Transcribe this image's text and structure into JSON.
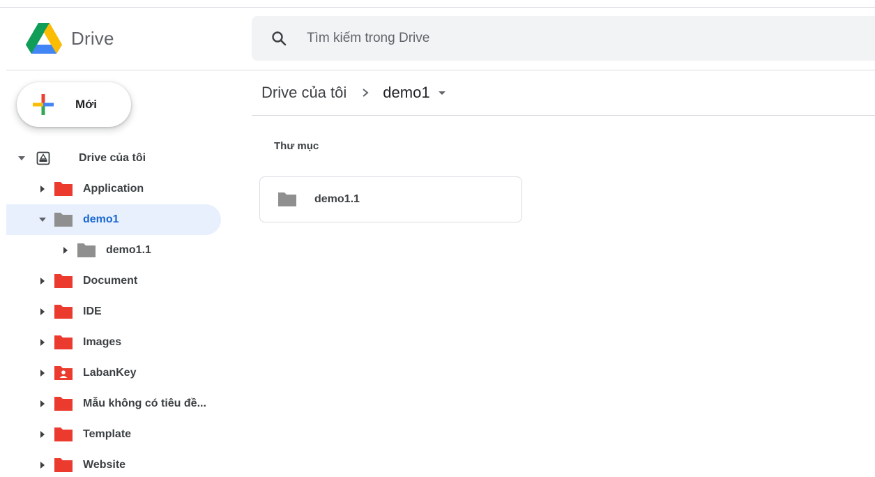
{
  "header": {
    "app_name": "Drive",
    "search_placeholder": "Tìm kiếm trong Drive"
  },
  "new_button": {
    "label": "Mới"
  },
  "sidebar": {
    "root_label": "Drive của tôi",
    "items": [
      {
        "label": "Application",
        "color": "#e53935",
        "icon": "folder-icon"
      },
      {
        "label": "demo1",
        "color": "#8f8f8f",
        "icon": "folder-icon"
      },
      {
        "label": "demo1.1",
        "color": "#8f8f8f",
        "icon": "folder-icon"
      },
      {
        "label": "Document",
        "color": "#e53935",
        "icon": "folder-icon"
      },
      {
        "label": "IDE",
        "color": "#e53935",
        "icon": "folder-icon"
      },
      {
        "label": "Images",
        "color": "#e53935",
        "icon": "folder-icon"
      },
      {
        "label": "LabanKey",
        "color": "#e53935",
        "icon": "shared-folder-icon"
      },
      {
        "label": "Mẫu không có tiêu đề...",
        "color": "#e53935",
        "icon": "folder-icon"
      },
      {
        "label": "Template",
        "color": "#e53935",
        "icon": "folder-icon"
      },
      {
        "label": "Website",
        "color": "#e53935",
        "icon": "folder-icon"
      }
    ]
  },
  "main": {
    "breadcrumb": {
      "root": "Drive của tôi",
      "current": "demo1"
    },
    "section_title": "Thư mục",
    "folders": [
      {
        "label": "demo1.1",
        "color": "#8f8f8f"
      }
    ]
  },
  "colors": {
    "accent": "#1967d2",
    "selected_bg": "#e8f0fe",
    "search_bg": "#f1f3f4"
  }
}
